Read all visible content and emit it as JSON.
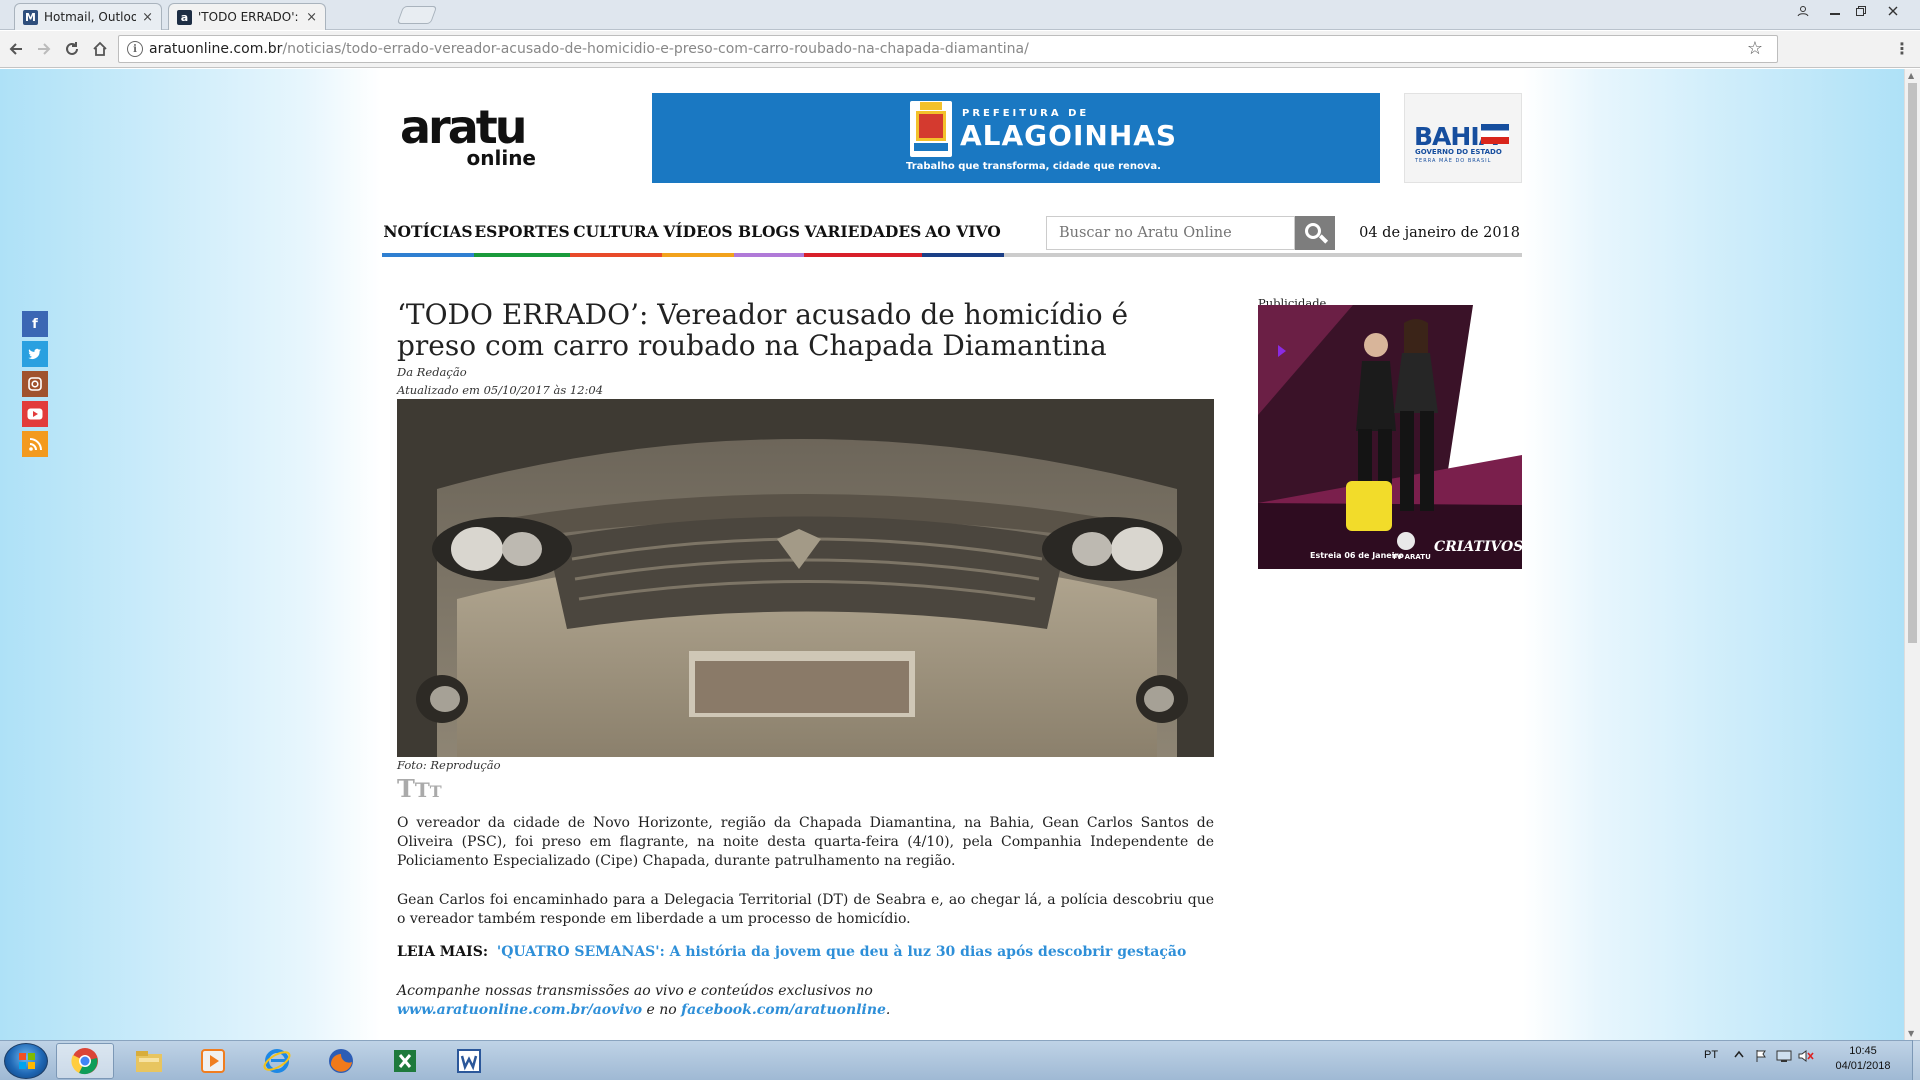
{
  "browser": {
    "tabs": [
      {
        "label": "Hotmail, Outlook, Skype",
        "favicon": "msn-icon",
        "close": "×",
        "active": false
      },
      {
        "label": "'TODO ERRADO': Vereado",
        "favicon": "aratu-icon",
        "close": "×",
        "active": true
      }
    ],
    "url_domain": "aratuonline.com.br",
    "url_path": "/noticias/todo-errado-vereador-acusado-de-homicidio-e-preso-com-carro-roubado-na-chapada-diamantina/",
    "info_glyph": "i",
    "star_glyph": "☆",
    "menu_glyph": "⋮"
  },
  "site": {
    "logo_line1": "aratu",
    "logo_line2": "online",
    "banner": {
      "prefeitura": "PREFEITURA DE",
      "city": "ALAGOINHAS",
      "tagline": "Trabalho que transforma, cidade que renova."
    },
    "bahia": {
      "title": "BAHIA",
      "subtitle": "GOVERNO DO ESTADO",
      "motto": "TERRA MÃE DO BRASIL"
    },
    "nav": [
      "NOTÍCIAS",
      "ESPORTES",
      "CULTURA",
      "VÍDEOS",
      "BLOGS",
      "VARIEDADES",
      "AO VIVO"
    ],
    "nav_colors": [
      "#2f7fd1",
      "#1a9a3b",
      "#e84a2a",
      "#f2a21c",
      "#b07ad8",
      "#d8202a",
      "#1b3f86"
    ],
    "search_placeholder": "Buscar no Aratu Online",
    "date": "04 de janeiro de 2018"
  },
  "article": {
    "title": "‘TODO ERRADO’: Vereador acusado de homicídio é preso com carro roubado na Chapada Diamantina",
    "author": "Da Redação",
    "updated": "Atualizado em 05/10/2017 às 12:04",
    "photo_credit": "Foto: Reprodução",
    "font_size_control": "TTT",
    "paragraph1": "O vereador da cidade de Novo Horizonte, região da Chapada Diamantina, na Bahia, Gean Carlos Santos de Oliveira (PSC), foi preso em flagrante, na noite desta quarta-feira (4/10), pela Companhia Independente de Policiamento Especializado (Cipe) Chapada, durante patrulhamento na região.",
    "paragraph2": "Gean Carlos foi encaminhado para a Delegacia Territorial (DT) de Seabra e, ao chegar lá, a polícia descobriu que o vereador também responde em liberdade a um processo de homicídio.",
    "leia_mais_label": "LEIA MAIS:",
    "leia_mais_link": "'QUATRO SEMANAS': A história da jovem que deu à luz 30 dias após descobrir gestação",
    "follow_text_1": "Acompanhe nossas transmissões ao vivo e conteúdos exclusivos no",
    "follow_link_1": "www.aratuonline.com.br/aovivo",
    "follow_text_2": "e no",
    "follow_link_2": "facebook.com/aratuonline",
    "follow_end": "."
  },
  "sidebar": {
    "ad_label": "Publicidade",
    "ad_text_1": "Estreia 06 de Janeiro",
    "ad_text_2": "TV ARATU",
    "ad_brand": "CRIATIVOS"
  },
  "social": [
    {
      "name": "facebook-icon",
      "glyph": "f",
      "color": "#3b67b4"
    },
    {
      "name": "twitter-icon",
      "glyph": "t",
      "color": "#2aa0e0"
    },
    {
      "name": "instagram-icon",
      "glyph": "◙",
      "color": "#a0522d"
    },
    {
      "name": "youtube-icon",
      "glyph": "▶",
      "color": "#e23b3b"
    },
    {
      "name": "rss-icon",
      "glyph": ")",
      "color": "#f39a1e"
    }
  ],
  "taskbar": {
    "apps": [
      "chrome-icon",
      "explorer-icon",
      "media-player-icon",
      "ie-icon",
      "firefox-icon",
      "excel-icon",
      "word-icon"
    ],
    "lang": "PT",
    "time": "10:45",
    "date": "04/01/2018"
  }
}
